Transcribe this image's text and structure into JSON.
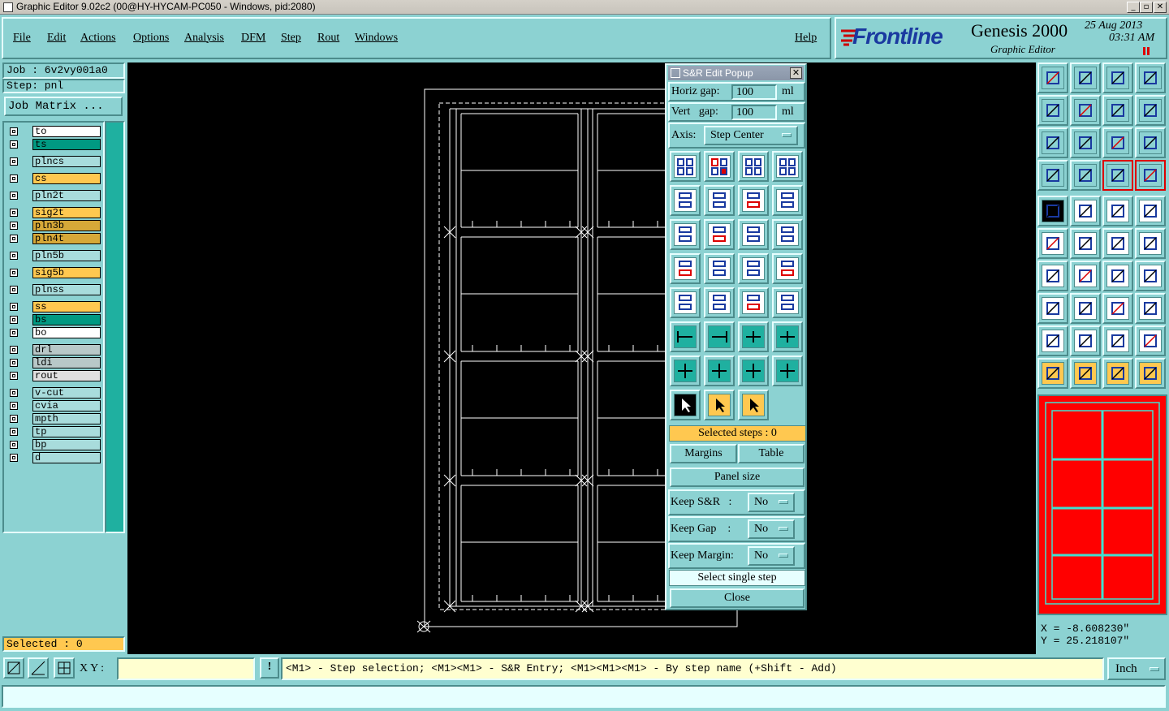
{
  "window": {
    "title": "Graphic Editor 9.02c2 (00@HY-HYCAM-PC050 - Windows, pid:2080)"
  },
  "menu": {
    "items": [
      "File",
      "Edit",
      "Actions",
      "Options",
      "Analysis",
      "DFM",
      "Step",
      "Rout",
      "Windows"
    ],
    "help": "Help"
  },
  "brand": {
    "logo": "Frontline",
    "product": "Genesis 2000",
    "subtitle": "Graphic Editor",
    "date": "25 Aug 2013",
    "time": "03:31 AM"
  },
  "job": {
    "job_label": "Job  : 6v2vy001a0",
    "step_label": "Step: pnl",
    "matrix_button": "Job Matrix ..."
  },
  "layers": [
    {
      "name": "to",
      "color": "#ffffff"
    },
    {
      "name": "ts",
      "color": "#009982"
    },
    {
      "name": "plncs",
      "color": "#a8dcdc"
    },
    {
      "name": "cs",
      "color": "#ffc850"
    },
    {
      "name": "pln2t",
      "color": "#a8dcdc"
    },
    {
      "name": "sig2t",
      "color": "#ffc850"
    },
    {
      "name": "pln3b",
      "color": "#d6a838"
    },
    {
      "name": "pln4t",
      "color": "#d6a838"
    },
    {
      "name": "pln5b",
      "color": "#a8dcdc"
    },
    {
      "name": "sig5b",
      "color": "#ffc850"
    },
    {
      "name": "plnss",
      "color": "#a8dcdc"
    },
    {
      "name": "ss",
      "color": "#ffc850"
    },
    {
      "name": "bs",
      "color": "#009982"
    },
    {
      "name": "bo",
      "color": "#ffffff"
    },
    {
      "name": "drl",
      "color": "#b8c8c8"
    },
    {
      "name": "ldi",
      "color": "#b8c8c8"
    },
    {
      "name": "rout",
      "color": "#e0e0e0"
    },
    {
      "name": "v-cut",
      "color": "#a8dcdc"
    },
    {
      "name": "cvia",
      "color": "#a8dcdc"
    },
    {
      "name": "mpth",
      "color": "#a8dcdc"
    },
    {
      "name": "tp",
      "color": "#a8dcdc"
    },
    {
      "name": "bp",
      "color": "#a8dcdc"
    },
    {
      "name": "d",
      "color": "#a8dcdc"
    }
  ],
  "selected_count": "Selected : 0",
  "popup": {
    "title": "S&R Edit Popup",
    "horiz_label": "Horiz gap:",
    "horiz_value": "100",
    "horiz_unit": "ml",
    "vert_label": "Vert   gap:",
    "vert_value": "100",
    "vert_unit": "ml",
    "axis_label": "Axis:",
    "axis_value": "Step Center",
    "selected_steps": "Selected steps : 0",
    "margins": "Margins",
    "table": "Table",
    "panel_size": "Panel size",
    "keep_sr_label": "Keep S&R   :",
    "keep_sr_value": "No",
    "keep_gap_label": "Keep Gap    :",
    "keep_gap_value": "No",
    "keep_margin_label": "Keep Margin:",
    "keep_margin_value": "No",
    "select_single": "Select single step",
    "close": "Close"
  },
  "coords": {
    "x": "X = -8.608230\"",
    "y": "Y = 25.218107\""
  },
  "status": {
    "xy_label": "X Y :",
    "xy_value": "",
    "hint": "<M1> - Step selection; <M1><M1> - S&R Entry; <M1><M1><M1> - By step name (+Shift - Add)",
    "units": "Inch"
  },
  "colors": {
    "panel": "#8cd2d2",
    "canvas": "#000000",
    "highlight": "#ffc850",
    "preview": "#ff0000"
  }
}
